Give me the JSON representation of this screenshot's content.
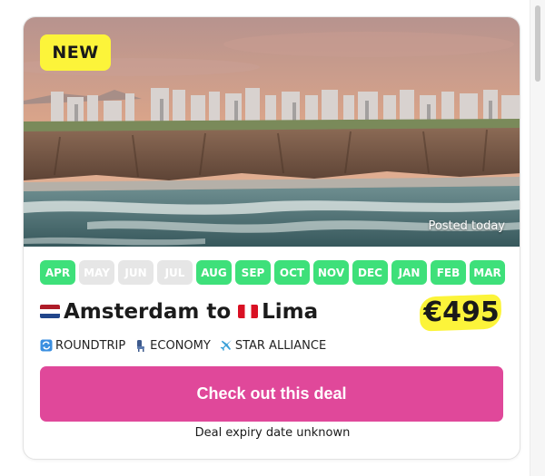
{
  "card": {
    "badge": "NEW",
    "posted": "Posted today",
    "months": [
      {
        "label": "APR",
        "available": true
      },
      {
        "label": "MAY",
        "available": false
      },
      {
        "label": "JUN",
        "available": false
      },
      {
        "label": "JUL",
        "available": false
      },
      {
        "label": "AUG",
        "available": true
      },
      {
        "label": "SEP",
        "available": true
      },
      {
        "label": "OCT",
        "available": true
      },
      {
        "label": "NOV",
        "available": true
      },
      {
        "label": "DEC",
        "available": true
      },
      {
        "label": "JAN",
        "available": true
      },
      {
        "label": "FEB",
        "available": true
      },
      {
        "label": "MAR",
        "available": true
      }
    ],
    "origin": "Amsterdam",
    "connector": "to",
    "destination": "Lima",
    "origin_flag": "netherlands-flag-icon",
    "destination_flag": "peru-flag-icon",
    "price": "€495",
    "features": [
      {
        "icon": "roundtrip-icon",
        "label": "ROUNDTRIP"
      },
      {
        "icon": "seat-icon",
        "label": "ECONOMY"
      },
      {
        "icon": "airplane-icon",
        "label": "STAR ALLIANCE"
      }
    ],
    "cta_label": "Check out this deal",
    "expiry": "Deal expiry date unknown"
  },
  "colors": {
    "month_available": "#3ee07a",
    "month_unavailable": "#e6e6e6",
    "badge": "#fcf43a",
    "cta": "#e0489a"
  }
}
